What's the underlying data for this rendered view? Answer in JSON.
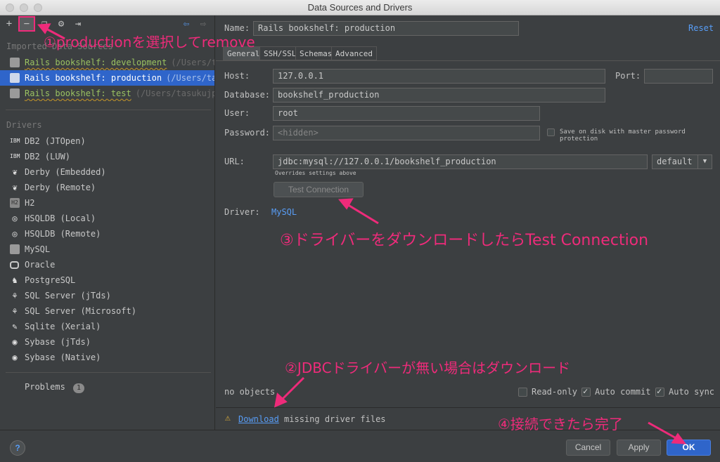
{
  "window": {
    "title": "Data Sources and Drivers"
  },
  "left": {
    "imported_label": "Imported Data Sources",
    "datasources": [
      {
        "name": "Rails bookshelf: development",
        "path": "(/Users/tasukujp/..."
      },
      {
        "name": "Rails bookshelf: production",
        "path": "(/Users/tasukujp/..."
      },
      {
        "name": "Rails bookshelf: test",
        "path": "(/Users/tasukujp/..."
      }
    ],
    "drivers_label": "Drivers",
    "drivers": [
      {
        "name": "DB2 (JTOpen)",
        "icon": "ibm-icon"
      },
      {
        "name": "DB2 (LUW)",
        "icon": "ibm-icon"
      },
      {
        "name": "Derby (Embedded)",
        "icon": "feather-icon"
      },
      {
        "name": "Derby (Remote)",
        "icon": "feather-icon"
      },
      {
        "name": "H2",
        "icon": "h2-icon"
      },
      {
        "name": "HSQLDB (Local)",
        "icon": "hsqldb-icon"
      },
      {
        "name": "HSQLDB (Remote)",
        "icon": "hsqldb-icon"
      },
      {
        "name": "MySQL",
        "icon": "dolphin-icon"
      },
      {
        "name": "Oracle",
        "icon": "oracle-icon"
      },
      {
        "name": "PostgreSQL",
        "icon": "elephant-icon"
      },
      {
        "name": "SQL Server (jTds)",
        "icon": "sqlserver-icon"
      },
      {
        "name": "SQL Server (Microsoft)",
        "icon": "sqlserver-icon"
      },
      {
        "name": "Sqlite (Xerial)",
        "icon": "sqlite-icon"
      },
      {
        "name": "Sybase (jTds)",
        "icon": "sybase-icon"
      },
      {
        "name": "Sybase (Native)",
        "icon": "sybase-icon"
      }
    ],
    "problems_label": "Problems",
    "problems_count": "1"
  },
  "right": {
    "name_label": "Name:",
    "name_value": "Rails bookshelf: production",
    "reset": "Reset",
    "tabs": [
      "General",
      "SSH/SSL",
      "Schemas",
      "Advanced"
    ],
    "host_label": "Host:",
    "host_value": "127.0.0.1",
    "port_label": "Port:",
    "port_value": "",
    "database_label": "Database:",
    "database_value": "bookshelf_production",
    "user_label": "User:",
    "user_value": "root",
    "password_label": "Password:",
    "password_value": "<hidden>",
    "save_on_disk": "Save on disk with master password protection",
    "url_label": "URL:",
    "url_value": "jdbc:mysql://127.0.0.1/bookshelf_production",
    "url_mode": "default",
    "overrides_note": "Overrides settings above",
    "test_connection": "Test Connection",
    "driver_label": "Driver:",
    "driver_value": "MySQL",
    "objects_status": "no objects",
    "readonly_label": "Read-only",
    "autocommit_label": "Auto commit",
    "autosync_label": "Auto sync",
    "download_link": "Download",
    "download_text": "missing driver files"
  },
  "footer": {
    "help": "?",
    "cancel": "Cancel",
    "apply": "Apply",
    "ok": "OK"
  },
  "annotations": {
    "a1": "①productionを選択してremove",
    "a2": "②JDBCドライバーが無い場合はダウンロード",
    "a3": "③ドライバーをダウンロードしたらTest Connection",
    "a4": "④接続できたら完了"
  },
  "colors": {
    "accent": "#2f65ca",
    "link": "#589df6",
    "annotation": "#ee2b7a",
    "ok_button": "#2f65ca"
  }
}
